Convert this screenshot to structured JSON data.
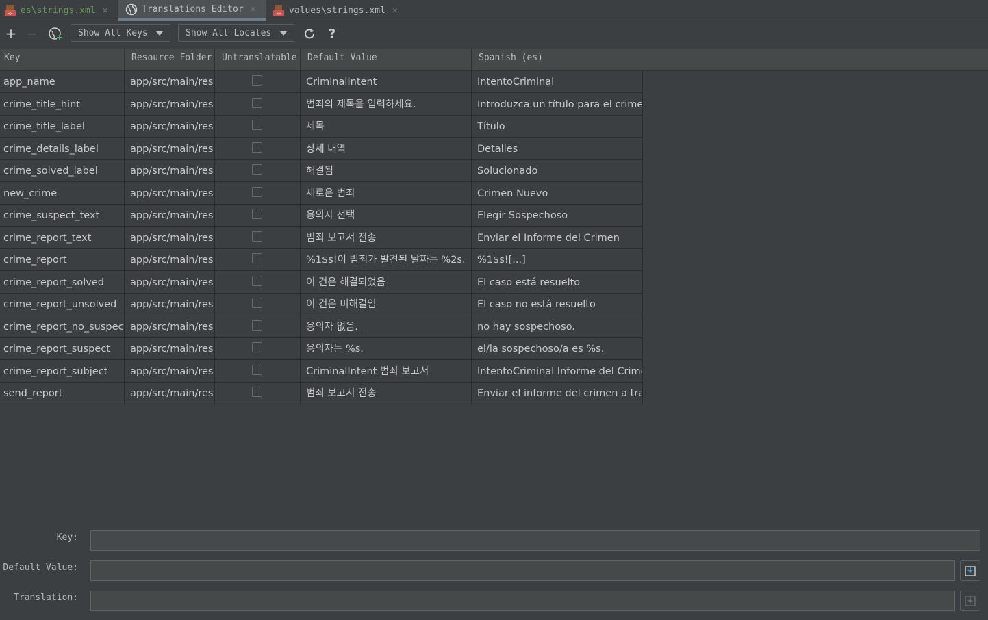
{
  "tabs": [
    {
      "label": "es\\strings.xml",
      "icon": "xml-file-icon"
    },
    {
      "label": "Translations Editor",
      "icon": "globe-icon"
    },
    {
      "label": "values\\strings.xml",
      "icon": "xml-file-icon"
    }
  ],
  "toolbar": {
    "keys_filter": "Show All Keys",
    "locales_filter": "Show All Locales",
    "help_label": "?"
  },
  "columns": [
    "Key",
    "Resource Folder",
    "Untranslatable",
    "Default Value",
    "Spanish (es)"
  ],
  "rows": [
    {
      "key": "app_name",
      "folder": "app/src/main/res",
      "untranslatable": false,
      "default": "CriminalIntent",
      "spanish": "IntentoCriminal"
    },
    {
      "key": "crime_title_hint",
      "folder": "app/src/main/res",
      "untranslatable": false,
      "default": "범죄의 제목을 입력하세요.",
      "spanish": "Introduzca un título para el crimen."
    },
    {
      "key": "crime_title_label",
      "folder": "app/src/main/res",
      "untranslatable": false,
      "default": "제목",
      "spanish": "Título"
    },
    {
      "key": "crime_details_label",
      "folder": "app/src/main/res",
      "untranslatable": false,
      "default": "상세 내역",
      "spanish": "Detalles"
    },
    {
      "key": "crime_solved_label",
      "folder": "app/src/main/res",
      "untranslatable": false,
      "default": "해결됨",
      "spanish": "Solucionado"
    },
    {
      "key": "new_crime",
      "folder": "app/src/main/res",
      "untranslatable": false,
      "default": "새로운 범죄",
      "spanish": "Crimen Nuevo"
    },
    {
      "key": "crime_suspect_text",
      "folder": "app/src/main/res",
      "untranslatable": false,
      "default": "용의자 선택",
      "spanish": "Elegir Sospechoso"
    },
    {
      "key": "crime_report_text",
      "folder": "app/src/main/res",
      "untranslatable": false,
      "default": "범죄 보고서 전송",
      "spanish": "Enviar el Informe del Crimen"
    },
    {
      "key": "crime_report",
      "folder": "app/src/main/res",
      "untranslatable": false,
      "default": "%1$s!이 범죄가 발견된 날짜는 %2s.",
      "spanish": "%1$s![...]"
    },
    {
      "key": "crime_report_solved",
      "folder": "app/src/main/res",
      "untranslatable": false,
      "default": "이 건은 해결되었음",
      "spanish": "El caso está resuelto"
    },
    {
      "key": "crime_report_unsolved",
      "folder": "app/src/main/res",
      "untranslatable": false,
      "default": "이 건은 미해결임",
      "spanish": "El caso no está resuelto"
    },
    {
      "key": "crime_report_no_suspect",
      "folder": "app/src/main/res",
      "untranslatable": false,
      "default": "용의자 없음.",
      "spanish": "no hay sospechoso."
    },
    {
      "key": "crime_report_suspect",
      "folder": "app/src/main/res",
      "untranslatable": false,
      "default": "용의자는 %s.",
      "spanish": "el/la sospechoso/a es %s."
    },
    {
      "key": "crime_report_subject",
      "folder": "app/src/main/res",
      "untranslatable": false,
      "default": "CriminalIntent 범죄 보고서",
      "spanish": "IntentoCriminal Informe del Crimen"
    },
    {
      "key": "send_report",
      "folder": "app/src/main/res",
      "untranslatable": false,
      "default": "범죄 보고서 전송",
      "spanish": "Enviar el informe del crimen a través"
    }
  ],
  "form": {
    "key_label": "Key:",
    "default_label": "Default Value:",
    "translation_label": "Translation:",
    "key_value": "",
    "default_value": "",
    "translation_value": ""
  },
  "colors": {
    "background": "#3c3f41",
    "header": "#45494a",
    "text": "#bbbbbb",
    "xml_tab_text": "#6a9a5a",
    "xml_icon": "#c75450"
  }
}
